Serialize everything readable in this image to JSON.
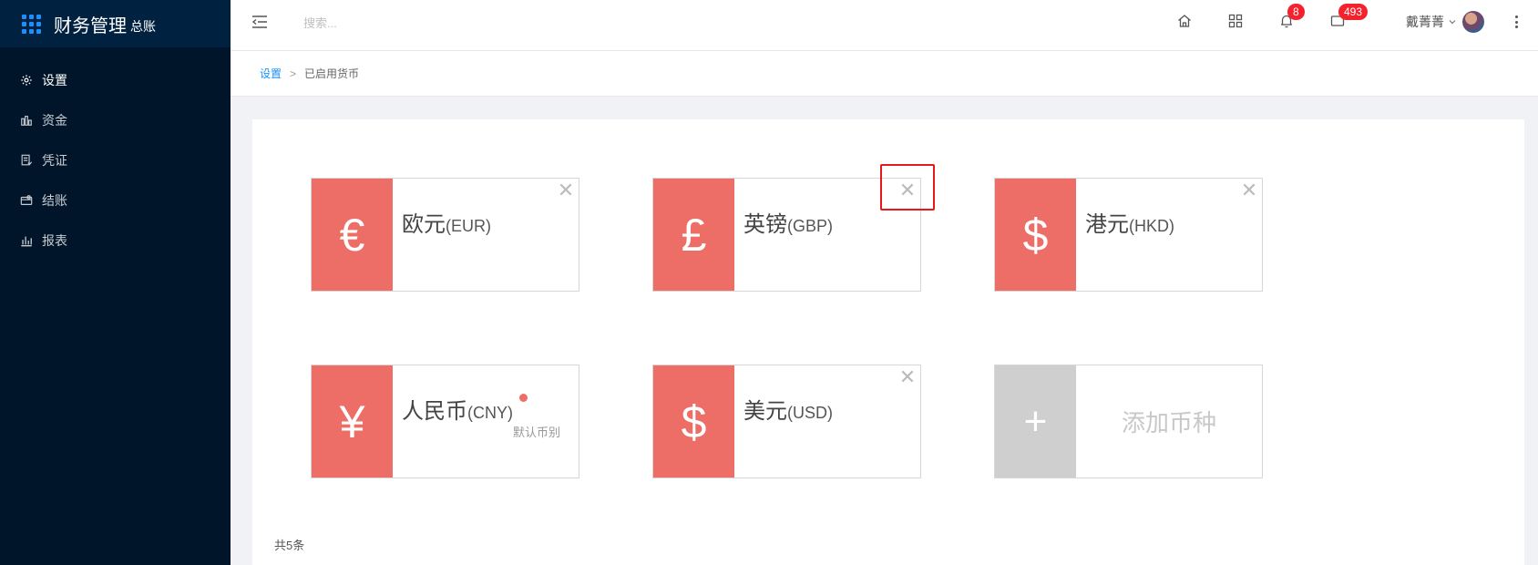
{
  "brand": {
    "title": "财务管理",
    "subtitle": "总账",
    "color": "#1890ff"
  },
  "sidebar": {
    "items": [
      {
        "label": "设置",
        "icon": "gear-icon",
        "active": true
      },
      {
        "label": "资金",
        "icon": "funds-icon",
        "active": false
      },
      {
        "label": "凭证",
        "icon": "voucher-icon",
        "active": false
      },
      {
        "label": "结账",
        "icon": "wallet-icon",
        "active": false
      },
      {
        "label": "报表",
        "icon": "bar-chart-icon",
        "active": false
      }
    ]
  },
  "header": {
    "search_placeholder": "搜索...",
    "notifications_count": "8",
    "messages_count": "493",
    "user_name": "戴菁菁"
  },
  "breadcrumb": {
    "parent": "设置",
    "separator": ">",
    "current": "已启用货币"
  },
  "currencies": [
    {
      "symbol": "€",
      "name": "欧元",
      "code": "(EUR)",
      "close": "✕"
    },
    {
      "symbol": "£",
      "name": "英镑",
      "code": "(GBP)",
      "close": "✕"
    },
    {
      "symbol": "$",
      "name": "港元",
      "code": "(HKD)",
      "close": "✕"
    },
    {
      "symbol": "¥",
      "name": "人民币",
      "code": "(CNY)",
      "default_label": "默认币别"
    },
    {
      "symbol": "$",
      "name": "美元",
      "code": "(USD)",
      "close": "✕"
    }
  ],
  "add_card": {
    "symbol": "+",
    "label": "添加币种"
  },
  "total_label": "共5条",
  "colors": {
    "accent": "#ec6e66",
    "sidebar_bg": "#001529",
    "link": "#1890ff",
    "badge": "#f5222d",
    "highlight": "#e81818"
  }
}
